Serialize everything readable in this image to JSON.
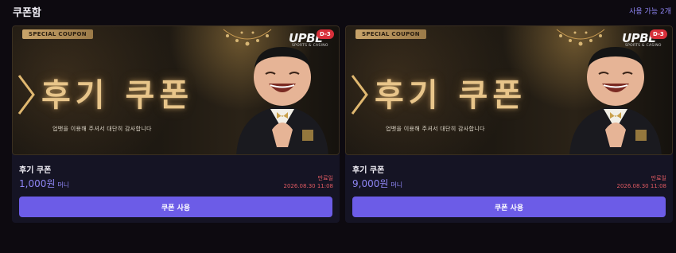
{
  "header": {
    "title": "쿠폰함",
    "available_text": "사용 가능 2개"
  },
  "colors": {
    "accent": "#6c5ce7",
    "amount": "#8f86f5",
    "expiry": "#e05a62",
    "badge": "#d8303a"
  },
  "coupons": [
    {
      "banner": {
        "tag": "SPECIAL COUPON",
        "logo": "UPBE",
        "logo_sub": "SPORTS & CASINO",
        "dday": "D-3",
        "headline": "후기 쿠폰",
        "subtext": "업뱃을 이용해 주셔서 대단히 감사합니다"
      },
      "name": "후기 쿠폰",
      "amount": "1,000원",
      "currency": "머니",
      "expiry_label": "만료일",
      "expiry_date": "2026.08.30 11:08",
      "button_label": "쿠폰 사용"
    },
    {
      "banner": {
        "tag": "SPECIAL COUPON",
        "logo": "UPBE",
        "logo_sub": "SPORTS & CASINO",
        "dday": "D-3",
        "headline": "후기 쿠폰",
        "subtext": "업뱃을 이용해 주셔서 대단히 감사합니다"
      },
      "name": "후기 쿠폰",
      "amount": "9,000원",
      "currency": "머니",
      "expiry_label": "만료일",
      "expiry_date": "2026.08.30 11:08",
      "button_label": "쿠폰 사용"
    }
  ]
}
